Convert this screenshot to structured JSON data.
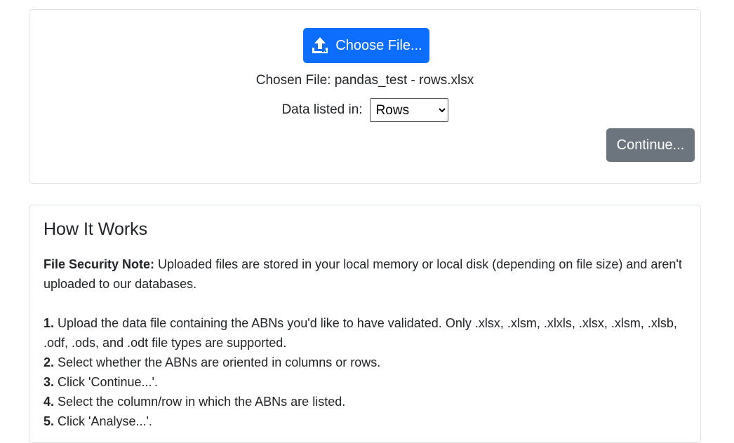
{
  "upload": {
    "choose_label": "Choose File...",
    "chosen_prefix": "Chosen File:",
    "chosen_file": "pandas_test - rows.xlsx",
    "data_listed_label": "Data listed in:",
    "orientation_selected": "Rows",
    "continue_label": "Continue..."
  },
  "how": {
    "title": "How It Works",
    "security_bold": "File Security Note:",
    "security_text": " Uploaded files are stored in your local memory or local disk (depending on file size) and aren't uploaded to our databases.",
    "steps": [
      {
        "num": "1.",
        "text": " Upload the data file containing the ABNs you'd like to have validated. Only .xlsx, .xlsm, .xlxls, .xlsx, .xlsm, .xlsb, .odf, .ods, and .odt file types are supported."
      },
      {
        "num": "2.",
        "text": " Select whether the ABNs are oriented in columns or rows."
      },
      {
        "num": "3.",
        "text": " Click 'Continue...'."
      },
      {
        "num": "4.",
        "text": " Select the column/row in which the ABNs are listed."
      },
      {
        "num": "5.",
        "text": " Click 'Analyse...'."
      }
    ]
  },
  "icons": {
    "upload": "upload-icon"
  },
  "colors": {
    "primary": "#0d6efd",
    "secondary": "#6c757d",
    "border": "#dfe2e6"
  }
}
